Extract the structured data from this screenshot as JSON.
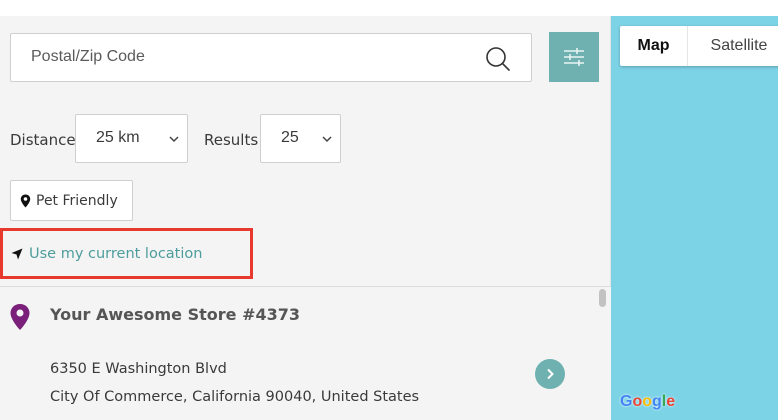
{
  "search": {
    "placeholder": "Postal/Zip Code"
  },
  "filters": {
    "distance_label": "Distance",
    "distance_value": "25 km",
    "results_label": "Results",
    "results_value": "25",
    "pet_friendly_label": "Pet Friendly"
  },
  "location": {
    "use_current_label": "Use my current location"
  },
  "stores": [
    {
      "name": "Your Awesome Store #4373",
      "address_line1": "6350 E Washington Blvd",
      "address_line2": "City Of Commerce, California 90040, United States"
    }
  ],
  "map": {
    "map_label": "Map",
    "satellite_label": "Satellite",
    "attribution": [
      "G",
      "o",
      "o",
      "g",
      "l",
      "e"
    ]
  },
  "colors": {
    "accent": "#6fb1b1",
    "link": "#4e9d9d",
    "highlight_border": "#e8392e",
    "store_pin": "#7a1f7a",
    "map_water": "#7dd3e6"
  }
}
